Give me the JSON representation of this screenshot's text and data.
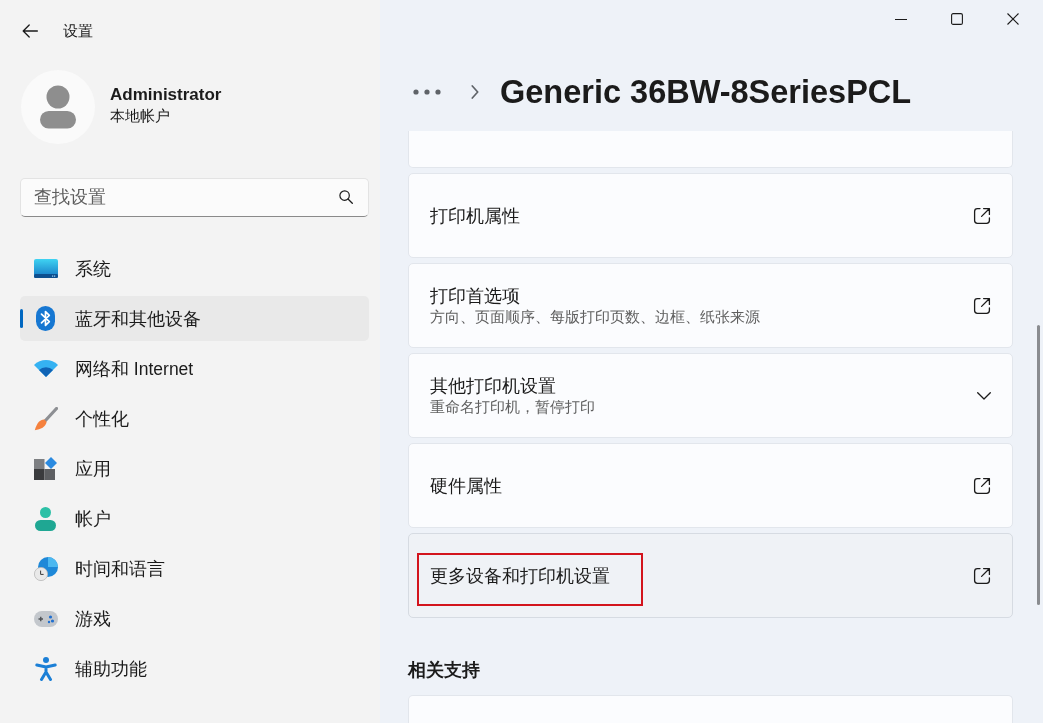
{
  "window": {
    "title": "设置"
  },
  "account": {
    "name": "Administrator",
    "type": "本地帐户"
  },
  "search": {
    "placeholder": "查找设置"
  },
  "sidebar": {
    "items": [
      {
        "label": "系统",
        "selected": false
      },
      {
        "label": "蓝牙和其他设备",
        "selected": true
      },
      {
        "label": "网络和 Internet",
        "selected": false
      },
      {
        "label": "个性化",
        "selected": false
      },
      {
        "label": "应用",
        "selected": false
      },
      {
        "label": "帐户",
        "selected": false
      },
      {
        "label": "时间和语言",
        "selected": false
      },
      {
        "label": "游戏",
        "selected": false
      },
      {
        "label": "辅助功能",
        "selected": false
      }
    ]
  },
  "header": {
    "title": "Generic 36BW-8SeriesPCL"
  },
  "cards": [
    {
      "kind": "clipped"
    },
    {
      "kind": "link",
      "title": "打印机属性",
      "highlighted": false,
      "hovered": false
    },
    {
      "kind": "link",
      "title": "打印首选项",
      "subtitle": "方向、页面顺序、每版打印页数、边框、纸张来源",
      "highlighted": false,
      "hovered": false
    },
    {
      "kind": "expander",
      "title": "其他打印机设置",
      "subtitle": "重命名打印机，暂停打印",
      "expanded": false,
      "highlighted": false,
      "hovered": false
    },
    {
      "kind": "link",
      "title": "硬件属性",
      "highlighted": false,
      "hovered": false
    },
    {
      "kind": "link",
      "title": "更多设备和打印机设置",
      "highlighted": true,
      "hovered": true
    }
  ],
  "related": {
    "heading": "相关支持",
    "cards": [
      {
        "kind": "clipped"
      }
    ]
  }
}
